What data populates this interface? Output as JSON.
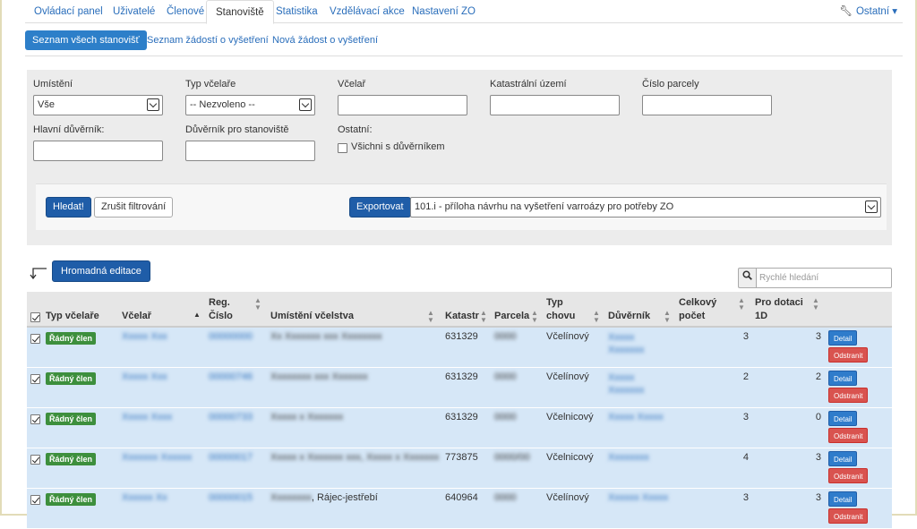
{
  "nav": {
    "tabs": [
      {
        "label": "Ovládací panel"
      },
      {
        "label": "Uživatelé"
      },
      {
        "label": "Členové"
      },
      {
        "label": "Stanoviště"
      },
      {
        "label": "Statistika"
      },
      {
        "label": "Vzdělávací akce"
      },
      {
        "label": "Nastavení ZO"
      }
    ],
    "active_tab": "Stanoviště",
    "other_menu": "Ostatní",
    "other_icon": "wrench-icon"
  },
  "subnav": {
    "items": [
      {
        "label": "Seznam všech stanovišť"
      },
      {
        "label": "Seznam žádostí o vyšetření"
      },
      {
        "label": "Nová žádost o vyšetření"
      }
    ]
  },
  "filter": {
    "umisteni_label": "Umístění",
    "umisteni_value": "Vše",
    "typ_label": "Typ včelaře",
    "typ_value": "-- Nezvoleno --",
    "vcelar_label": "Včelař",
    "katastr_label": "Katastrální území",
    "parcela_label": "Číslo parcely",
    "hlavni_label": "Hlavní důvěrník:",
    "duvernik_label": "Důvěrník pro stanoviště",
    "ostatni_label": "Ostatní:",
    "vsichni_label": "Všichni s důvěrníkem",
    "search_button": "Hledat!",
    "reset_button": "Zrušit filtrování",
    "export_button": "Exportovat",
    "export_value": "101.i - příloha návrhu na vyšetření varroázy pro potřeby ZO"
  },
  "bulk": {
    "edit_button": "Hromadná editace",
    "quick_search_placeholder": "Rychlé hledání"
  },
  "table": {
    "headers": {
      "typ": "Typ včelaře",
      "vcelar": "Včelař",
      "reg1": "Reg.",
      "reg2": "Číslo",
      "umisteni": "Umístění včelstva",
      "katastr": "Katastr",
      "parcela": "Parcela",
      "typ_chovu1": "Typ",
      "typ_chovu2": "chovu",
      "duvernik": "Důvěrník",
      "celkovy1": "Celkový",
      "celkovy2": "počet",
      "dotace1": "Pro dotaci",
      "dotace2": "1D"
    },
    "rows": [
      {
        "badge": "Řádný člen",
        "katastr": "631329",
        "typ_chovu": "Včelínový",
        "celkovy": "3",
        "dotace": "3",
        "detail": "Detail",
        "remove": "Odstranit"
      },
      {
        "badge": "Řádný člen",
        "katastr": "631329",
        "typ_chovu": "Včelínový",
        "celkovy": "2",
        "dotace": "2",
        "detail": "Detail",
        "remove": "Odstranit"
      },
      {
        "badge": "Řádný člen",
        "katastr": "631329",
        "typ_chovu": "Včelnicový",
        "celkovy": "3",
        "dotace": "0",
        "detail": "Detail",
        "remove": "Odstranit"
      },
      {
        "badge": "Řádný člen",
        "katastr": "773875",
        "typ_chovu": "Včelnicový",
        "celkovy": "4",
        "dotace": "3",
        "detail": "Detail",
        "remove": "Odstranit"
      },
      {
        "badge": "Řádný člen",
        "umisteni_suffix": ", Rájec-jestřebí",
        "katastr": "640964",
        "typ_chovu": "Včelínový",
        "celkovy": "3",
        "dotace": "3",
        "detail": "Detail",
        "remove": "Odstranit"
      }
    ]
  },
  "colors": {
    "primary": "#1f5da8",
    "row_bg": "#d6e7f7",
    "badge": "#3d8f3d",
    "danger": "#d9534f"
  }
}
